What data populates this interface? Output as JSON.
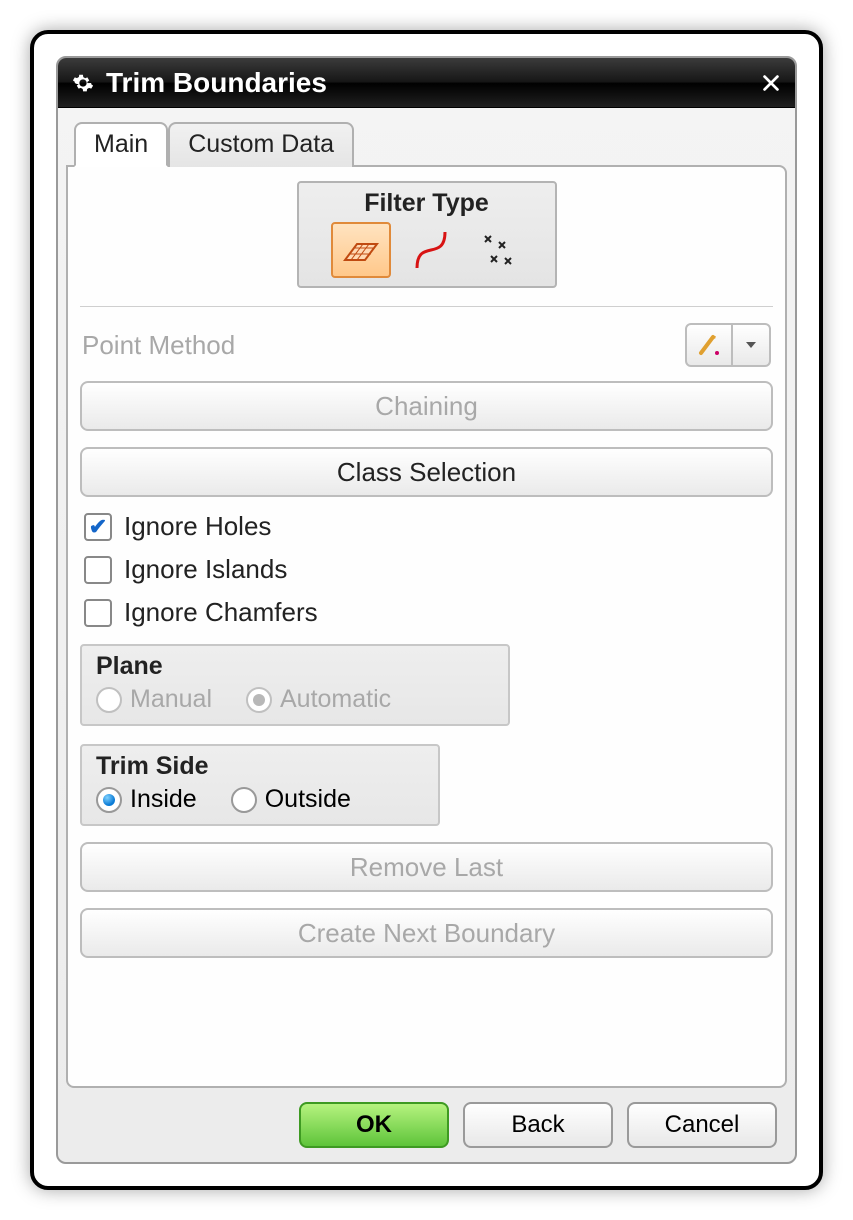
{
  "title": "Trim Boundaries",
  "tabs": {
    "main": "Main",
    "custom": "Custom Data",
    "active": "main"
  },
  "filter": {
    "label": "Filter Type",
    "icons": [
      "surface-icon",
      "curve-icon",
      "points-icon"
    ],
    "selected": 0
  },
  "point_method": {
    "label": "Point Method"
  },
  "buttons": {
    "chaining": "Chaining",
    "class_selection": "Class Selection",
    "remove_last": "Remove Last",
    "create_next": "Create Next Boundary"
  },
  "checks": {
    "ignore_holes": {
      "label": "Ignore Holes",
      "checked": true
    },
    "ignore_islands": {
      "label": "Ignore Islands",
      "checked": false
    },
    "ignore_chamfers": {
      "label": "Ignore Chamfers",
      "checked": false
    }
  },
  "plane": {
    "title": "Plane",
    "manual": "Manual",
    "automatic": "Automatic",
    "selected": "automatic",
    "disabled": true
  },
  "trim_side": {
    "title": "Trim Side",
    "inside": "Inside",
    "outside": "Outside",
    "selected": "inside"
  },
  "footer": {
    "ok": "OK",
    "back": "Back",
    "cancel": "Cancel"
  }
}
